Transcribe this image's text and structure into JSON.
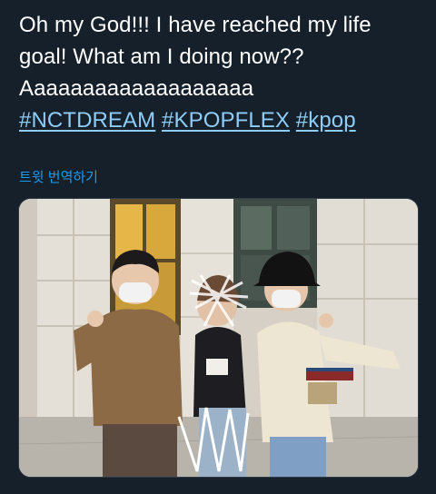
{
  "tweet": {
    "text_line1": "Oh my God!!! I have reached my life",
    "text_line2": "goal! What am I doing now??",
    "text_line3": "Aaaaaaaaaaaaaaaaaaa",
    "hashtags": [
      "#NCTDREAM",
      "#KPOPFLEX",
      "#kpop"
    ],
    "translate_label": "트윗 번역하기"
  },
  "media": {
    "description_icon": "photo-attachment",
    "colors": {
      "background": "#15202b",
      "hashtag": "#8ecdf8",
      "translate_link": "#1d9bf0"
    }
  }
}
